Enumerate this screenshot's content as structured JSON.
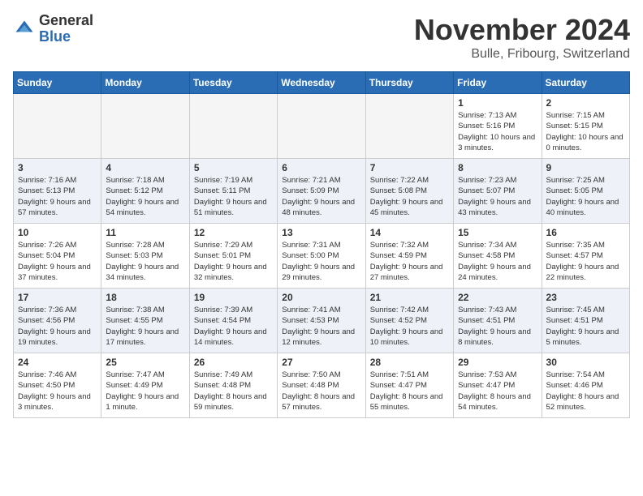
{
  "header": {
    "logo_general": "General",
    "logo_blue": "Blue",
    "month_title": "November 2024",
    "location": "Bulle, Fribourg, Switzerland"
  },
  "weekdays": [
    "Sunday",
    "Monday",
    "Tuesday",
    "Wednesday",
    "Thursday",
    "Friday",
    "Saturday"
  ],
  "weeks": [
    [
      {
        "day": "",
        "sunrise": "",
        "sunset": "",
        "daylight": "",
        "empty": true
      },
      {
        "day": "",
        "sunrise": "",
        "sunset": "",
        "daylight": "",
        "empty": true
      },
      {
        "day": "",
        "sunrise": "",
        "sunset": "",
        "daylight": "",
        "empty": true
      },
      {
        "day": "",
        "sunrise": "",
        "sunset": "",
        "daylight": "",
        "empty": true
      },
      {
        "day": "",
        "sunrise": "",
        "sunset": "",
        "daylight": "",
        "empty": true
      },
      {
        "day": "1",
        "sunrise": "Sunrise: 7:13 AM",
        "sunset": "Sunset: 5:16 PM",
        "daylight": "Daylight: 10 hours and 3 minutes.",
        "empty": false
      },
      {
        "day": "2",
        "sunrise": "Sunrise: 7:15 AM",
        "sunset": "Sunset: 5:15 PM",
        "daylight": "Daylight: 10 hours and 0 minutes.",
        "empty": false
      }
    ],
    [
      {
        "day": "3",
        "sunrise": "Sunrise: 7:16 AM",
        "sunset": "Sunset: 5:13 PM",
        "daylight": "Daylight: 9 hours and 57 minutes.",
        "empty": false
      },
      {
        "day": "4",
        "sunrise": "Sunrise: 7:18 AM",
        "sunset": "Sunset: 5:12 PM",
        "daylight": "Daylight: 9 hours and 54 minutes.",
        "empty": false
      },
      {
        "day": "5",
        "sunrise": "Sunrise: 7:19 AM",
        "sunset": "Sunset: 5:11 PM",
        "daylight": "Daylight: 9 hours and 51 minutes.",
        "empty": false
      },
      {
        "day": "6",
        "sunrise": "Sunrise: 7:21 AM",
        "sunset": "Sunset: 5:09 PM",
        "daylight": "Daylight: 9 hours and 48 minutes.",
        "empty": false
      },
      {
        "day": "7",
        "sunrise": "Sunrise: 7:22 AM",
        "sunset": "Sunset: 5:08 PM",
        "daylight": "Daylight: 9 hours and 45 minutes.",
        "empty": false
      },
      {
        "day": "8",
        "sunrise": "Sunrise: 7:23 AM",
        "sunset": "Sunset: 5:07 PM",
        "daylight": "Daylight: 9 hours and 43 minutes.",
        "empty": false
      },
      {
        "day": "9",
        "sunrise": "Sunrise: 7:25 AM",
        "sunset": "Sunset: 5:05 PM",
        "daylight": "Daylight: 9 hours and 40 minutes.",
        "empty": false
      }
    ],
    [
      {
        "day": "10",
        "sunrise": "Sunrise: 7:26 AM",
        "sunset": "Sunset: 5:04 PM",
        "daylight": "Daylight: 9 hours and 37 minutes.",
        "empty": false
      },
      {
        "day": "11",
        "sunrise": "Sunrise: 7:28 AM",
        "sunset": "Sunset: 5:03 PM",
        "daylight": "Daylight: 9 hours and 34 minutes.",
        "empty": false
      },
      {
        "day": "12",
        "sunrise": "Sunrise: 7:29 AM",
        "sunset": "Sunset: 5:01 PM",
        "daylight": "Daylight: 9 hours and 32 minutes.",
        "empty": false
      },
      {
        "day": "13",
        "sunrise": "Sunrise: 7:31 AM",
        "sunset": "Sunset: 5:00 PM",
        "daylight": "Daylight: 9 hours and 29 minutes.",
        "empty": false
      },
      {
        "day": "14",
        "sunrise": "Sunrise: 7:32 AM",
        "sunset": "Sunset: 4:59 PM",
        "daylight": "Daylight: 9 hours and 27 minutes.",
        "empty": false
      },
      {
        "day": "15",
        "sunrise": "Sunrise: 7:34 AM",
        "sunset": "Sunset: 4:58 PM",
        "daylight": "Daylight: 9 hours and 24 minutes.",
        "empty": false
      },
      {
        "day": "16",
        "sunrise": "Sunrise: 7:35 AM",
        "sunset": "Sunset: 4:57 PM",
        "daylight": "Daylight: 9 hours and 22 minutes.",
        "empty": false
      }
    ],
    [
      {
        "day": "17",
        "sunrise": "Sunrise: 7:36 AM",
        "sunset": "Sunset: 4:56 PM",
        "daylight": "Daylight: 9 hours and 19 minutes.",
        "empty": false
      },
      {
        "day": "18",
        "sunrise": "Sunrise: 7:38 AM",
        "sunset": "Sunset: 4:55 PM",
        "daylight": "Daylight: 9 hours and 17 minutes.",
        "empty": false
      },
      {
        "day": "19",
        "sunrise": "Sunrise: 7:39 AM",
        "sunset": "Sunset: 4:54 PM",
        "daylight": "Daylight: 9 hours and 14 minutes.",
        "empty": false
      },
      {
        "day": "20",
        "sunrise": "Sunrise: 7:41 AM",
        "sunset": "Sunset: 4:53 PM",
        "daylight": "Daylight: 9 hours and 12 minutes.",
        "empty": false
      },
      {
        "day": "21",
        "sunrise": "Sunrise: 7:42 AM",
        "sunset": "Sunset: 4:52 PM",
        "daylight": "Daylight: 9 hours and 10 minutes.",
        "empty": false
      },
      {
        "day": "22",
        "sunrise": "Sunrise: 7:43 AM",
        "sunset": "Sunset: 4:51 PM",
        "daylight": "Daylight: 9 hours and 8 minutes.",
        "empty": false
      },
      {
        "day": "23",
        "sunrise": "Sunrise: 7:45 AM",
        "sunset": "Sunset: 4:51 PM",
        "daylight": "Daylight: 9 hours and 5 minutes.",
        "empty": false
      }
    ],
    [
      {
        "day": "24",
        "sunrise": "Sunrise: 7:46 AM",
        "sunset": "Sunset: 4:50 PM",
        "daylight": "Daylight: 9 hours and 3 minutes.",
        "empty": false
      },
      {
        "day": "25",
        "sunrise": "Sunrise: 7:47 AM",
        "sunset": "Sunset: 4:49 PM",
        "daylight": "Daylight: 9 hours and 1 minute.",
        "empty": false
      },
      {
        "day": "26",
        "sunrise": "Sunrise: 7:49 AM",
        "sunset": "Sunset: 4:48 PM",
        "daylight": "Daylight: 8 hours and 59 minutes.",
        "empty": false
      },
      {
        "day": "27",
        "sunrise": "Sunrise: 7:50 AM",
        "sunset": "Sunset: 4:48 PM",
        "daylight": "Daylight: 8 hours and 57 minutes.",
        "empty": false
      },
      {
        "day": "28",
        "sunrise": "Sunrise: 7:51 AM",
        "sunset": "Sunset: 4:47 PM",
        "daylight": "Daylight: 8 hours and 55 minutes.",
        "empty": false
      },
      {
        "day": "29",
        "sunrise": "Sunrise: 7:53 AM",
        "sunset": "Sunset: 4:47 PM",
        "daylight": "Daylight: 8 hours and 54 minutes.",
        "empty": false
      },
      {
        "day": "30",
        "sunrise": "Sunrise: 7:54 AM",
        "sunset": "Sunset: 4:46 PM",
        "daylight": "Daylight: 8 hours and 52 minutes.",
        "empty": false
      }
    ]
  ]
}
